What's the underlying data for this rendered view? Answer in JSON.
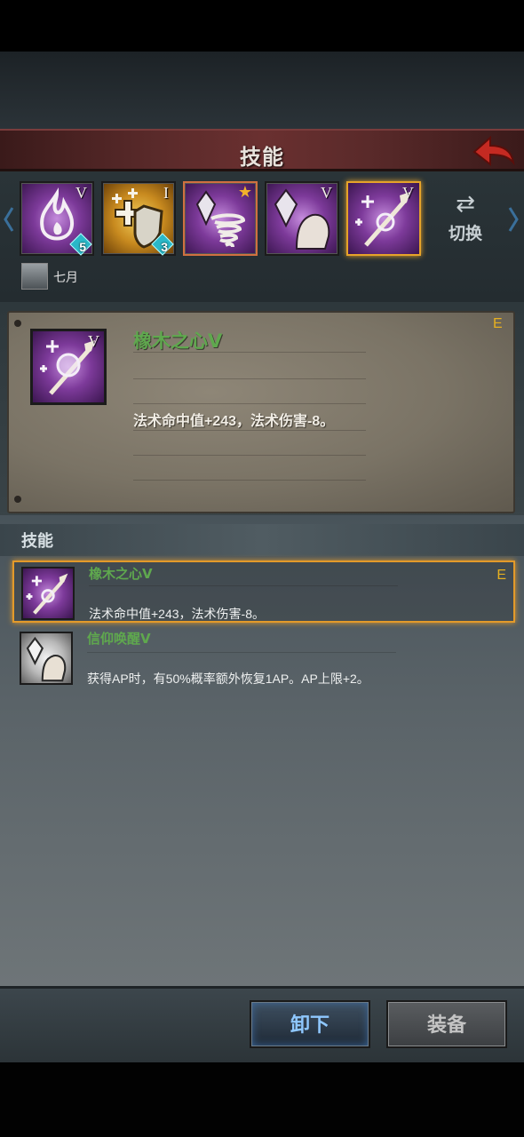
{
  "header": {
    "title": "技能"
  },
  "slots": [
    {
      "roman": "V",
      "badge": "5",
      "color": "purple",
      "icon": "flame-icon"
    },
    {
      "roman": "I",
      "badge": "3",
      "color": "gold",
      "icon": "shield-cross-icon"
    },
    {
      "roman": "",
      "badge": "",
      "color": "purple",
      "icon": "crystal-tornado-icon",
      "starred": true
    },
    {
      "roman": "V",
      "badge": "",
      "color": "purple",
      "icon": "crystal-arm-icon"
    },
    {
      "roman": "V",
      "badge": "",
      "color": "purple",
      "icon": "magic-staff-icon",
      "selected": true
    }
  ],
  "switch": {
    "label": "切换",
    "icon": "swap-arrows-icon"
  },
  "owner": {
    "name": "七月"
  },
  "detail": {
    "name": "橡木之心Ⅴ",
    "roman": "V",
    "grade": "E",
    "description": "法术命中值+243，法术伤害-8。"
  },
  "list": {
    "title": "技能",
    "items": [
      {
        "name": "橡木之心Ⅴ",
        "description": "法术命中值+243，法术伤害-8。",
        "grade": "E",
        "selected": true
      },
      {
        "name": "信仰唤醒Ⅴ",
        "description": "获得AP时，有50%概率额外恢复1AP。AP上限+2。",
        "grade": "",
        "selected": false
      }
    ]
  },
  "buttons": {
    "unequip": "卸下",
    "equip": "装备"
  },
  "colors": {
    "skill_name_green": "#5fa84e",
    "grade_gold": "#e6b020",
    "selected_border": "#e39a2a"
  }
}
